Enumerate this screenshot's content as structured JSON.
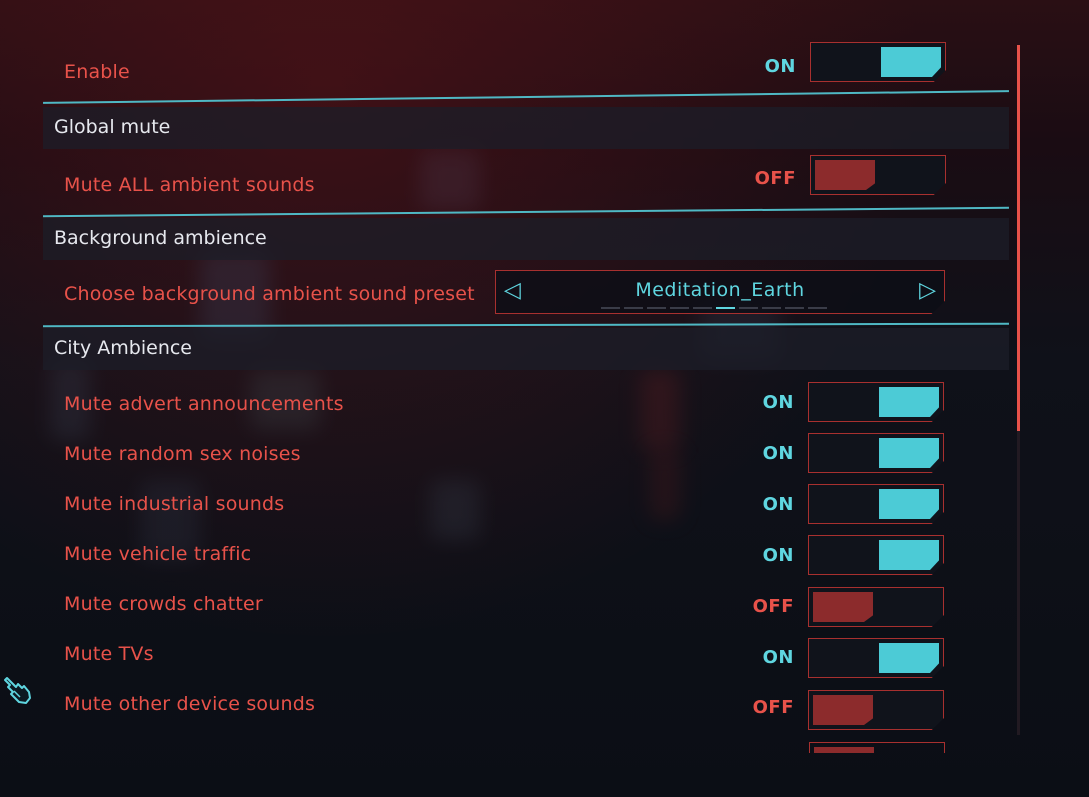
{
  "enable": {
    "label": "Enable",
    "state": "ON"
  },
  "sections": [
    {
      "title": "Global mute",
      "settings": [
        {
          "label": "Mute ALL ambient sounds",
          "state": "OFF"
        }
      ]
    },
    {
      "title": "Background ambience",
      "settings": [
        {
          "label": "Choose background ambient sound preset",
          "value": "Meditation_Earth"
        }
      ]
    },
    {
      "title": "City Ambience",
      "settings": [
        {
          "label": "Mute advert announcements",
          "state": "ON"
        },
        {
          "label": "Mute random sex noises",
          "state": "ON"
        },
        {
          "label": "Mute industrial sounds",
          "state": "ON"
        },
        {
          "label": "Mute vehicle traffic",
          "state": "ON"
        },
        {
          "label": "Mute crowds chatter",
          "state": "OFF"
        },
        {
          "label": "Mute TVs",
          "state": "ON"
        },
        {
          "label": "Mute other device sounds",
          "state": "OFF"
        }
      ]
    }
  ],
  "colors": {
    "accent_on": "#5fd6e0",
    "accent_off": "#e8524a",
    "knob_on": "#4ccbd6",
    "knob_off": "#8c2b2c",
    "label": "#e8524a",
    "section_title": "#e6e8ee"
  }
}
